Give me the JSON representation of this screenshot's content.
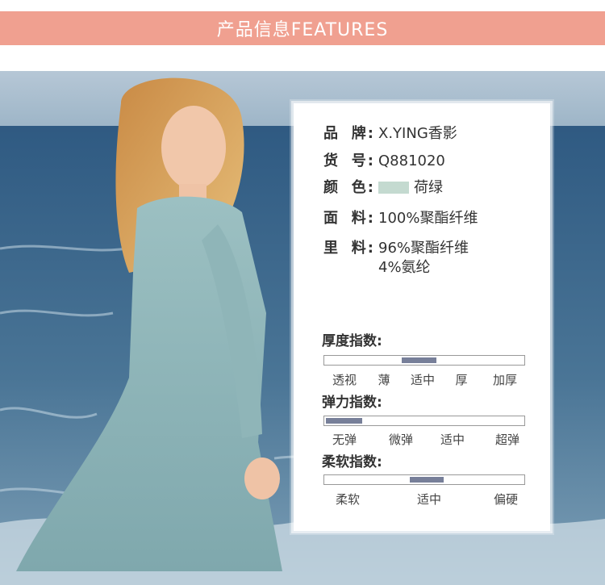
{
  "header": {
    "title": "产品信息FEATURES",
    "background": "#f0a090"
  },
  "photo": {
    "sky_color": "#9fb7c9",
    "sea_color": "#3f6a8c",
    "dress_color": "#8cb3b6"
  },
  "specs": {
    "brand": {
      "label_chars": [
        "品",
        "牌"
      ],
      "value": "X.YING香影"
    },
    "sku": {
      "label_chars": [
        "货",
        "号"
      ],
      "value": "Q881020"
    },
    "color": {
      "label_chars": [
        "颜",
        "色"
      ],
      "swatch": "#c4dad0",
      "value": "荷绿"
    },
    "fabric": {
      "label_chars": [
        "面",
        "料"
      ],
      "value": "100%聚酯纤维"
    },
    "lining": {
      "label_chars": [
        "里",
        "料"
      ],
      "value": "96%聚酯纤维",
      "value2": "4%氨纶"
    },
    "colon": ":"
  },
  "indexes": {
    "bar_color": "#777f99",
    "thickness": {
      "title": "厚度指数:",
      "level_start": 0.385,
      "level_end": 0.56,
      "labels": [
        "透视",
        "薄",
        "适中",
        "厚",
        "加厚"
      ]
    },
    "elasticity": {
      "title": "弹力指数:",
      "level_start": 0.0,
      "level_end": 0.185,
      "labels": [
        "无弹",
        "微弹",
        "适中",
        "超弹"
      ]
    },
    "softness": {
      "title": "柔软指数:",
      "level_start": 0.425,
      "level_end": 0.6,
      "labels": [
        "柔软",
        "适中",
        "偏硬"
      ]
    }
  }
}
